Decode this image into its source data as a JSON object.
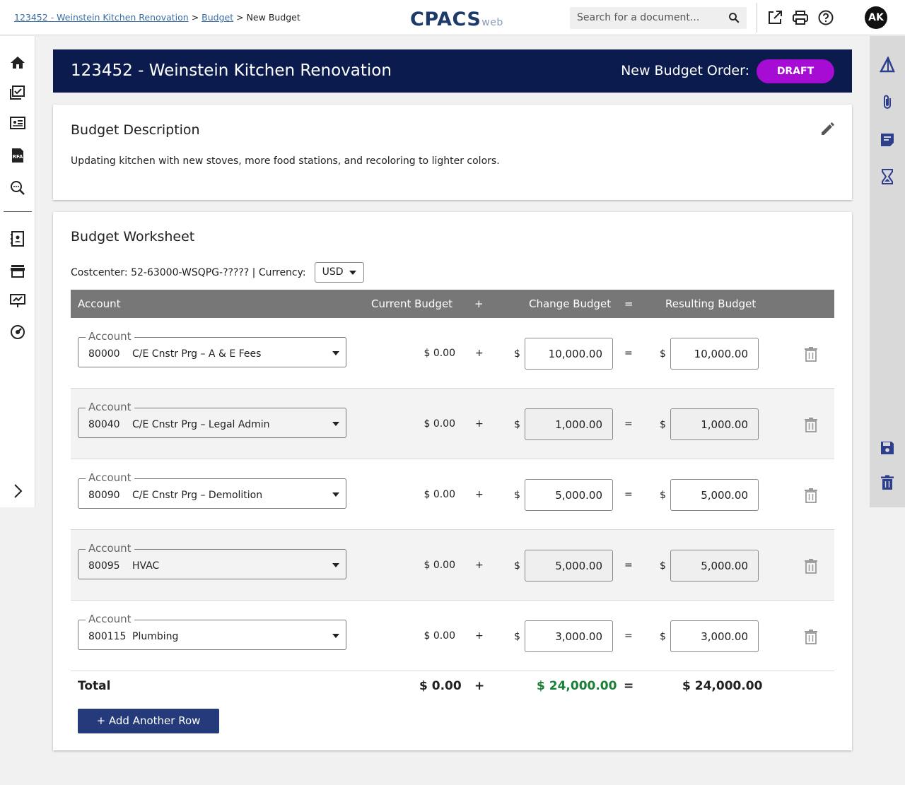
{
  "breadcrumb": {
    "project": "123452 - Weinstein Kitchen Renovation",
    "sep1": ">",
    "budget": "Budget",
    "sep2": ">",
    "current": "New Budget"
  },
  "logo": {
    "main": "CPACS",
    "suffix": "web"
  },
  "search": {
    "placeholder": "Search for a document..."
  },
  "user": {
    "initials": "AK"
  },
  "header": {
    "title": "123452 - Weinstein Kitchen Renovation",
    "order_label": "New Budget Order:",
    "status": "DRAFT"
  },
  "description": {
    "title": "Budget Description",
    "text": "Updating kitchen with new stoves, more food stations, and recoloring to lighter colors."
  },
  "worksheet": {
    "title": "Budget Worksheet",
    "costcenter": "Costcenter: 52-63000-WSQPG-????? | Currency:",
    "currency": "USD",
    "columns": {
      "account": "Account",
      "current": "Current Budget",
      "plus": "+",
      "change": "Change Budget",
      "equals": "=",
      "resulting": "Resulting Budget"
    },
    "field_label": "Account",
    "currency_symbol": "$",
    "rows": [
      {
        "code": "80000",
        "name": "C/E Cnstr Prg – A & E Fees",
        "current": "$ 0.00",
        "change": "10,000.00",
        "result": "10,000.00"
      },
      {
        "code": "80040",
        "name": "C/E Cnstr Prg – Legal Admin",
        "current": "$ 0.00",
        "change": "1,000.00",
        "result": "1,000.00"
      },
      {
        "code": "80090",
        "name": "C/E Cnstr Prg – Demolition",
        "current": "$ 0.00",
        "change": "5,000.00",
        "result": "5,000.00"
      },
      {
        "code": "80095",
        "name": "HVAC",
        "current": "$ 0.00",
        "change": "5,000.00",
        "result": "5,000.00"
      },
      {
        "code": "800115",
        "name": "Plumbing",
        "current": "$ 0.00",
        "change": "3,000.00",
        "result": "3,000.00"
      }
    ],
    "total": {
      "label": "Total",
      "current": "$ 0.00",
      "plus": "+",
      "change": "$ 24,000.00",
      "equals": "=",
      "result": "$ 24,000.00"
    },
    "add_row_label": "+ Add Another Row"
  },
  "colors": {
    "banner": "#0b1b4d",
    "draft": "#a60cd4",
    "button": "#243a7a",
    "total_change": "#1a7f37"
  },
  "icons": {
    "left": [
      "home-icon",
      "tasks-icon",
      "contract-icon",
      "rfa-icon",
      "search-review-icon",
      "contacts-icon",
      "store-icon",
      "presentation-icon",
      "dashboard-icon",
      "expand-icon"
    ],
    "right": [
      "triangle-icon",
      "attachment-icon",
      "notes-icon",
      "hourglass-icon",
      "save-icon",
      "delete-icon"
    ]
  }
}
